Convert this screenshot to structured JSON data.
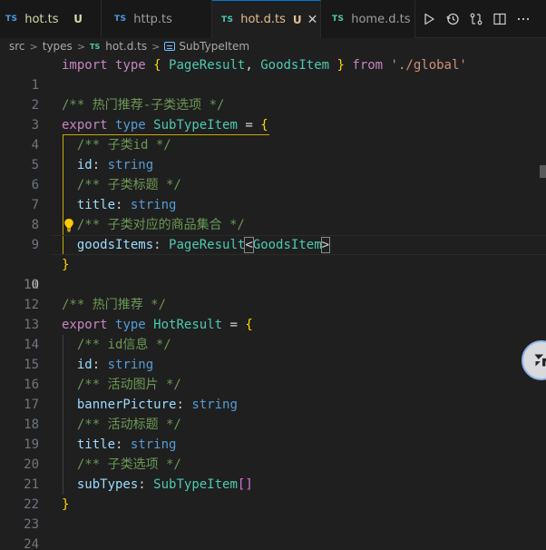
{
  "tabs": [
    {
      "lang": "TS",
      "name": "hot.ts",
      "badge": "U"
    },
    {
      "lang": "TS",
      "name": "http.ts"
    },
    {
      "lang": "TS",
      "name": "hot.d.ts",
      "badge": "U",
      "close": "✕"
    },
    {
      "lang": "TS",
      "name": "home.d.ts"
    }
  ],
  "breadcrumb": {
    "parts": [
      "src",
      "types"
    ],
    "file_lang": "TS",
    "file": "hot.d.ts",
    "symbol": "SubTypeItem",
    "separator": ">"
  },
  "editor": {
    "active_line": 10,
    "lines": [
      {
        "n": "1"
      },
      {
        "n": "2"
      },
      {
        "n": "3"
      },
      {
        "n": "4"
      },
      {
        "n": "5"
      },
      {
        "n": "6"
      },
      {
        "n": "7"
      },
      {
        "n": "8"
      },
      {
        "n": "9"
      },
      {
        "n": "10"
      },
      {
        "n": "11"
      },
      {
        "n": "12"
      },
      {
        "n": "13"
      },
      {
        "n": "14"
      },
      {
        "n": "15"
      },
      {
        "n": "16"
      },
      {
        "n": "17"
      },
      {
        "n": "18"
      },
      {
        "n": "19"
      },
      {
        "n": "20"
      },
      {
        "n": "21"
      },
      {
        "n": "22"
      },
      {
        "n": "23"
      },
      {
        "n": "24"
      }
    ],
    "tokens": {
      "import": "import",
      "type": "type",
      "from": "from",
      "export": "export",
      "open_brace": "{",
      "close_brace": "}",
      "page_result": "PageResult",
      "goods_item": "GoodsItem",
      "comma": ",",
      "module": "'./global'",
      "c_recommend_sub": "/** 热门推荐-子类选项 */",
      "sub_type_item": "SubTypeItem",
      "eq": "=",
      "c_sub_id": "/** 子类id */",
      "id": "id",
      "colon": ":",
      "string": "string",
      "c_sub_title": "/** 子类标题 */",
      "title": "title",
      "c_sub_goods": "/** 子类对应的商品集合 */",
      "goods_items": "goodsItems",
      "lt": "<",
      "gt": ">",
      "c_recommend": "/** 热门推荐 */",
      "hot_result": "HotResult",
      "c_id_info": "/** id信息 */",
      "c_banner": "/** 活动图片 */",
      "banner_picture": "bannerPicture",
      "c_act_title": "/** 活动标题 */",
      "c_sub_options": "/** 子类选项 */",
      "sub_types": "subTypes",
      "arr": "[]"
    }
  },
  "colors": {
    "keyword": "#569cd6",
    "type": "#4ec9b0",
    "property": "#9cdcfe",
    "string": "#ce9178",
    "comment": "#6a9955",
    "bracket_level1": "#ffd700",
    "bracket_level2": "#da70d6"
  },
  "icons": {
    "toolbar": [
      "run-icon",
      "timeline-icon",
      "compare-changes-icon",
      "split-editor-icon",
      "more-actions-icon"
    ],
    "gutter": "lightbulb-icon",
    "floating": "copilot-icon"
  }
}
